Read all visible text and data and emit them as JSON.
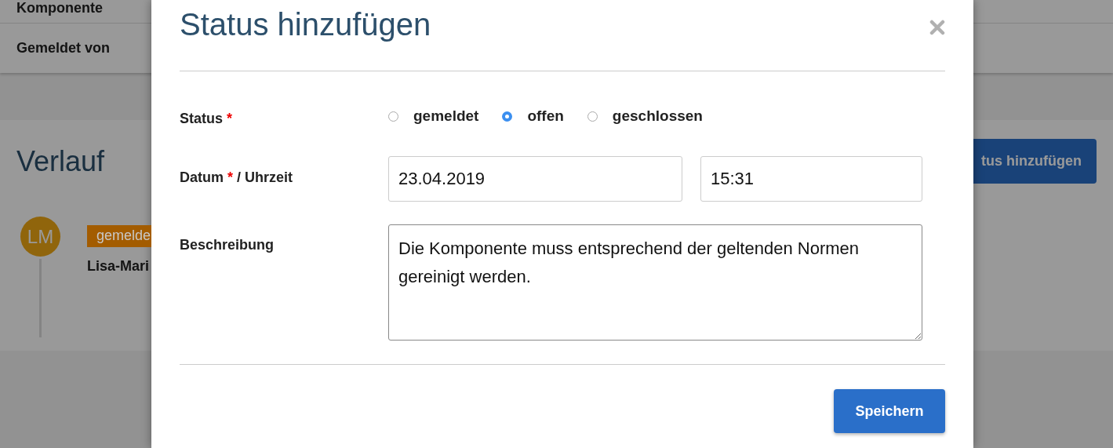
{
  "details": [
    {
      "label": "Komponente"
    },
    {
      "label": "Gemeldet von"
    }
  ],
  "history": {
    "title": "Verlauf",
    "add_button": "tus hinzufügen",
    "entries": [
      {
        "initials": "LM",
        "status": "gemelde",
        "color": "#a35c00",
        "author": "Lisa-Mari"
      }
    ]
  },
  "modal": {
    "title": "Status hinzufügen",
    "status": {
      "label": "Status",
      "required_mark": "*",
      "options": [
        {
          "label": "gemeldet",
          "selected": false
        },
        {
          "label": "offen",
          "selected": true
        },
        {
          "label": "geschlossen",
          "selected": false
        }
      ]
    },
    "date": {
      "label": "Datum",
      "required_mark": "*",
      "suffix": "/ Uhrzeit",
      "date_value": "23.04.2019",
      "time_value": "15:31"
    },
    "description": {
      "label": "Beschreibung",
      "value": "Die Komponente muss entsprechend der geltenden Normen gereinigt werden."
    },
    "save_button": "Speichern"
  }
}
